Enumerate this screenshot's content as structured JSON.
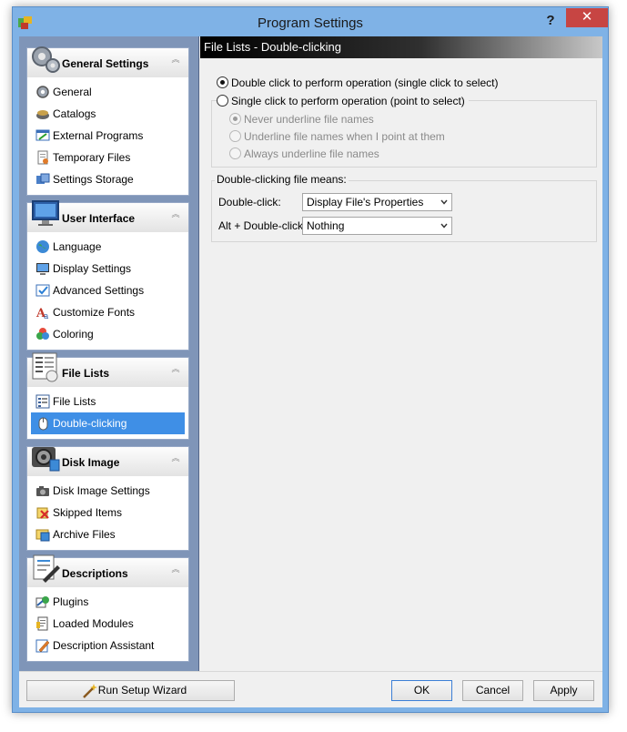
{
  "window": {
    "title": "Program Settings",
    "help": "?",
    "close": "✕"
  },
  "sidebar": {
    "groups": [
      {
        "title": "General Settings",
        "items": [
          "General",
          "Catalogs",
          "External Programs",
          "Temporary Files",
          "Settings Storage"
        ]
      },
      {
        "title": "User Interface",
        "items": [
          "Language",
          "Display Settings",
          "Advanced Settings",
          "Customize Fonts",
          "Coloring"
        ]
      },
      {
        "title": "File Lists",
        "items": [
          "File Lists",
          "Double-clicking"
        ]
      },
      {
        "title": "Disk Image",
        "items": [
          "Disk Image Settings",
          "Skipped Items",
          "Archive Files"
        ]
      },
      {
        "title": "Descriptions",
        "items": [
          "Plugins",
          "Loaded Modules",
          "Description Assistant"
        ]
      }
    ],
    "collapse_glyph": "︽"
  },
  "content": {
    "header": "File Lists - Double-clicking",
    "radio_double": "Double click to perform operation (single click to select)",
    "radio_single": "Single click to perform operation (point to select)",
    "sub_never": "Never underline file names",
    "sub_point": "Underline file names when I point at them",
    "sub_always": "Always underline file names",
    "group_legend": "Double-clicking file means:",
    "dbl_label": "Double-click:",
    "dbl_value": "Display File's Properties",
    "alt_label": "Alt + Double-click:",
    "alt_value": "Nothing"
  },
  "buttons": {
    "wizard": "Run Setup Wizard",
    "ok": "OK",
    "cancel": "Cancel",
    "apply": "Apply"
  },
  "colors": {
    "selected": "#3f8fe6",
    "sidebar_bg": "#7f95b8",
    "close": "#c74543"
  }
}
